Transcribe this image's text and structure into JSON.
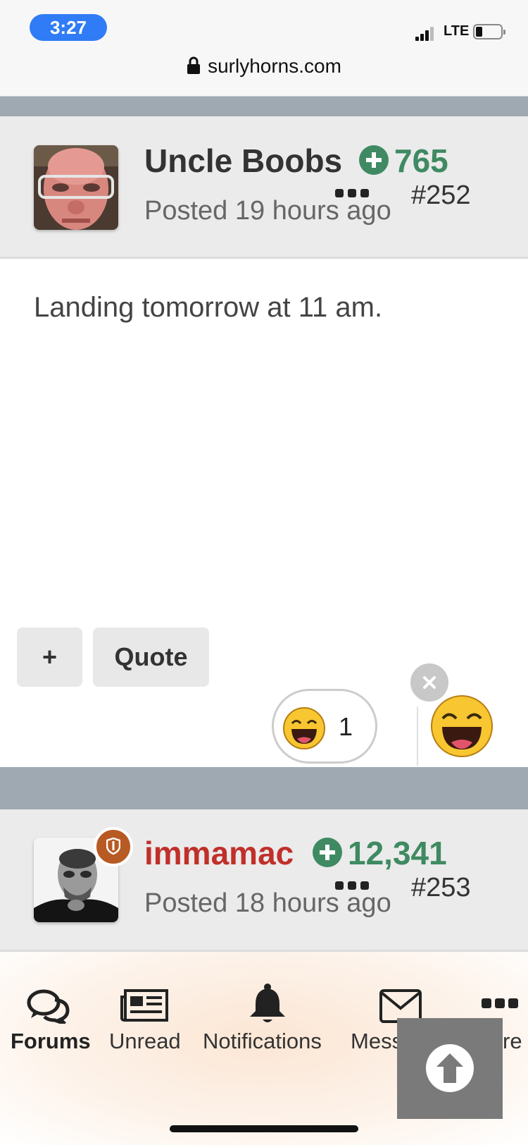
{
  "status_bar": {
    "time": "3:27",
    "network": "LTE"
  },
  "browser": {
    "url": "surlyhorns.com"
  },
  "posts": [
    {
      "author": "Uncle Boobs",
      "reputation": "765",
      "posted": "Posted 19 hours ago",
      "number": "#252",
      "body": "Landing tomorrow at 11 am."
    },
    {
      "author": "immamac",
      "reputation": "12,341",
      "posted": "Posted 18 hours ago",
      "number": "#253"
    }
  ],
  "actions": {
    "add_label": "+",
    "quote_label": "Quote"
  },
  "reactions": {
    "icon": "laughing-emoji",
    "count": "1"
  },
  "colors": {
    "reputation": "#3f8a62",
    "admin_name": "#c0302a",
    "divider": "#9ea9b2",
    "time_pill": "#2f7cf6"
  },
  "nav": {
    "forums": "Forums",
    "unread": "Unread",
    "notifications": "Notifications",
    "messages": "Mess",
    "more": "re"
  }
}
